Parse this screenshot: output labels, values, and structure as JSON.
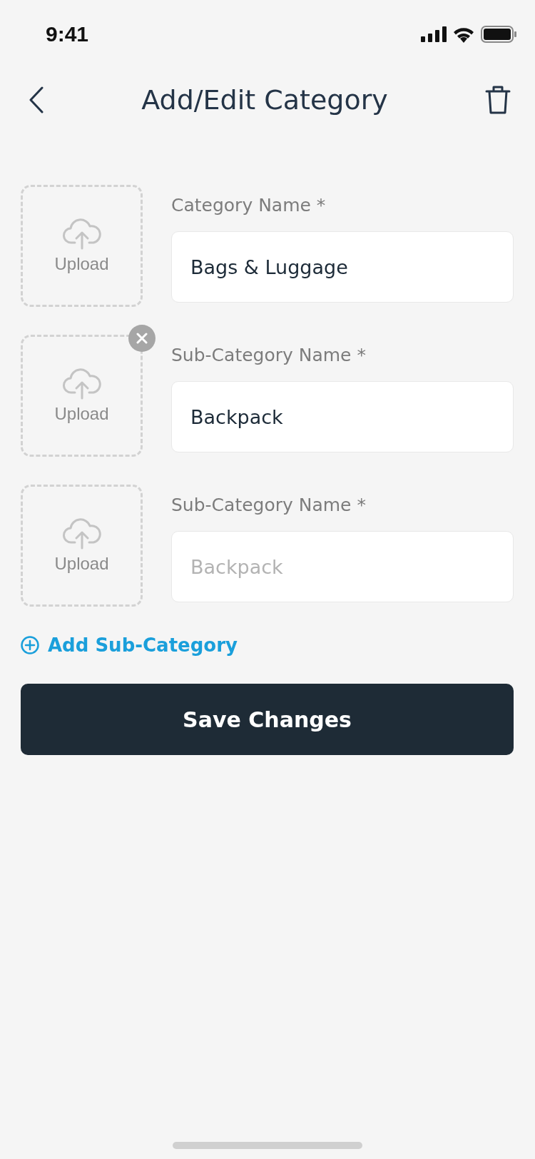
{
  "status_bar": {
    "time": "9:41"
  },
  "header": {
    "title": "Add/Edit Category"
  },
  "rows": [
    {
      "upload": "Upload",
      "label": "Category Name *",
      "value": "Bags & Luggage",
      "removable": false
    },
    {
      "upload": "Upload",
      "label": "Sub-Category Name *",
      "value": "Backpack",
      "removable": true
    },
    {
      "upload": "Upload",
      "label": "Sub-Category Name *",
      "placeholder": "Backpack",
      "removable": false
    }
  ],
  "add_link": "Add Sub-Category",
  "save_button": "Save Changes"
}
